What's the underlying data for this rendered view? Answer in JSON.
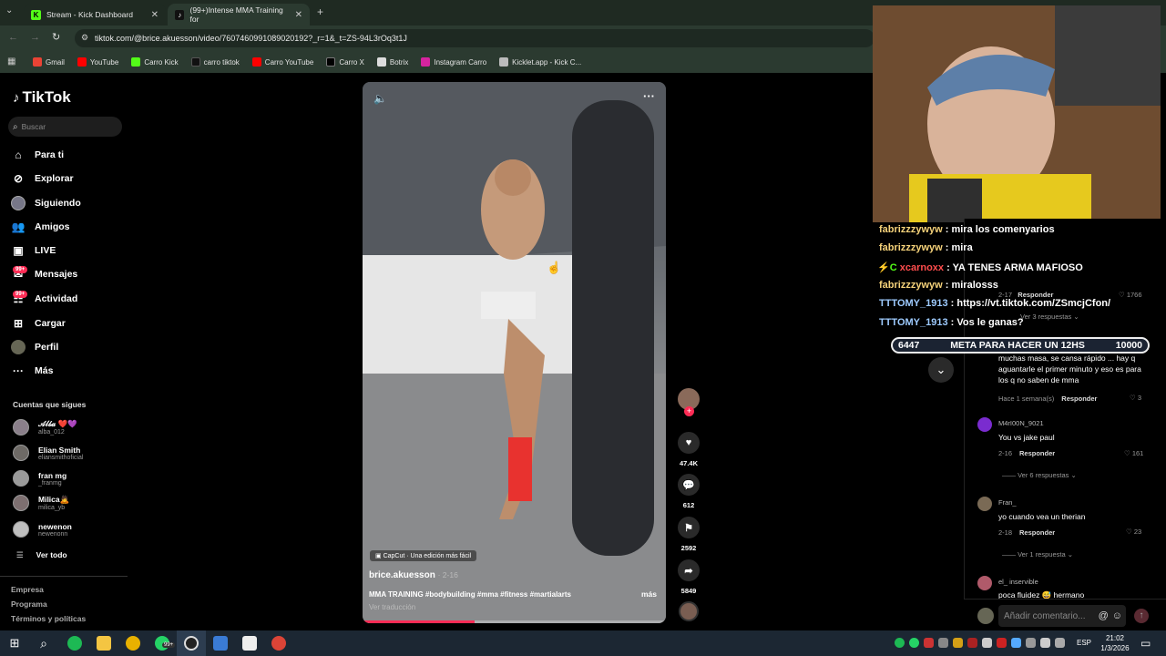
{
  "browser": {
    "tabs": [
      {
        "label": "Stream - Kick Dashboard",
        "active": false
      },
      {
        "label": "(99+)Intense MMA Training for",
        "active": true
      }
    ],
    "url": "tiktok.com/@brice.akuesson/video/7607460991089020192?_r=1&_t=ZS-94L3rOq3t1J",
    "bookmarks": [
      "Gmail",
      "YouTube",
      "Carro Kick",
      "carro tiktok",
      "Carro YouTube",
      "Carro X",
      "Botrix",
      "Instagram Carro",
      "Kicklet.app - Kick C..."
    ]
  },
  "sidebar": {
    "logo": "TikTok",
    "search_placeholder": "Buscar",
    "nav": [
      "Para ti",
      "Explorar",
      "Siguiendo",
      "Amigos",
      "LIVE",
      "Mensajes",
      "Actividad",
      "Cargar",
      "Perfil",
      "Más"
    ],
    "badges": {
      "mensajes": "99+",
      "actividad": "99+"
    },
    "following_title": "Cuentas que sigues",
    "following": [
      {
        "name": "𝒜𝓁𝒷𝒶 ❤️💜",
        "user": "alba_012"
      },
      {
        "name": "Elian Smith",
        "user": "eliansmithoficial"
      },
      {
        "name": "fran mg",
        "user": "_franmg"
      },
      {
        "name": "Milica🙇",
        "user": "milica_yb"
      },
      {
        "name": "newenon",
        "user": "newenonn"
      }
    ],
    "see_all": "Ver todo",
    "footer": [
      "Empresa",
      "Programa",
      "Términos y políticas"
    ]
  },
  "video": {
    "capcut": "CapCut · Una edición más fácil",
    "author": "brice.akuesson",
    "date": "2-16",
    "caption": "MMA TRAINING #bodybuilding #mma #fitness #martialarts",
    "more": "más",
    "translate": "Ver traducción",
    "progress": 0.37,
    "likes": "47.4K",
    "comments": "612",
    "saves": "2592",
    "shares": "5849"
  },
  "overlay_chat": [
    {
      "user": "fabrizzzywyw",
      "msg": "mira los comenyarios",
      "color": "#f5d27a"
    },
    {
      "user": "fabrizzzywyw",
      "msg": "mira",
      "color": "#f5d27a"
    },
    {
      "user": "xcarnoxx",
      "msg": "YA TENES ARMA MAFIOSO",
      "color": "#ff4d4d"
    },
    {
      "user": "fabrizzzywyw",
      "msg": "miralosss",
      "color": "#f5d27a"
    },
    {
      "user": "TTTOMY_1913",
      "msg": "https://vt.tiktok.com/ZSmcjCfon/",
      "color": "#9ecbff"
    },
    {
      "user": "TTTOMY_1913",
      "msg": "Vos le ganas?",
      "color": "#9ecbff"
    }
  ],
  "meta_bar": {
    "current": "6447",
    "label": "META PARA HACER UN 12HS",
    "goal": "10000"
  },
  "comments_panel": {
    "partial_top": {
      "date": "2-17",
      "reply": "Responder",
      "likes": "1766",
      "replies": "Ver 3 respuestas"
    },
    "c1": {
      "text": "muchas masa, se cansa rápido ... hay q aguantarle el primer minuto y eso es para los q no saben de mma",
      "date": "Hace 1 semana(s)",
      "reply": "Responder",
      "likes": "3"
    },
    "c2": {
      "user": "M4rI00N_9021",
      "text": "You vs jake paul",
      "date": "2-16",
      "reply": "Responder",
      "likes": "161",
      "replies": "Ver 6 respuestas"
    },
    "c3": {
      "user": "Fran_",
      "text": "yo cuando vea un therian",
      "date": "2-18",
      "reply": "Responder",
      "likes": "23",
      "replies": "Ver 1 respuesta"
    },
    "c4": {
      "user": "el_ inservible",
      "text": "poca fluidez 😅 hermano"
    },
    "input_placeholder": "Añadir comentario..."
  },
  "taskbar": {
    "lang": "ESP",
    "time": "21:02",
    "date": "1/3/2026",
    "badge": "99+"
  },
  "colors": {
    "tiktok_red": "#fe2c55",
    "accent_green": "#53fc18"
  }
}
